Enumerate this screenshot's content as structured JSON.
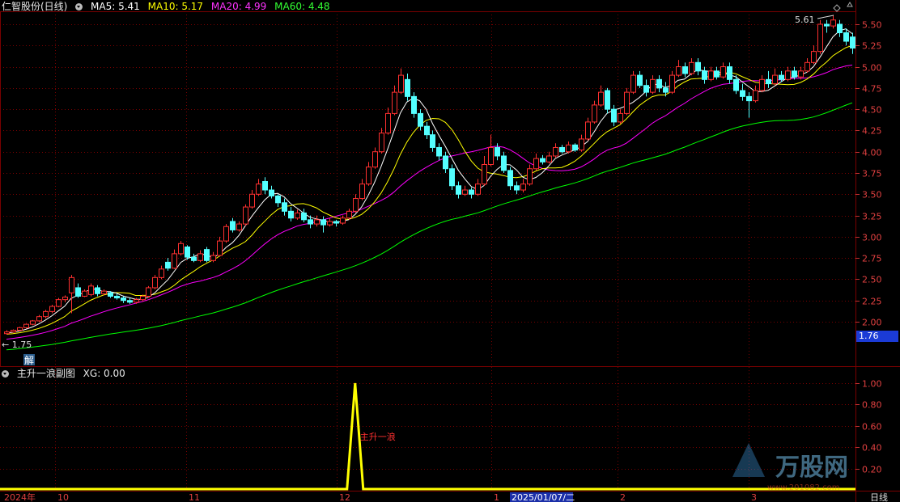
{
  "main_header": {
    "title": "仁智股份(日线)",
    "ma5": "MA5: 5.41",
    "ma10": "MA10: 5.17",
    "ma20": "MA20: 4.99",
    "ma60": "MA60: 4.48"
  },
  "sub_header": {
    "title": "主升一浪副图",
    "xg": "XG: 0.00"
  },
  "annotations": {
    "high_label": "5.61",
    "low_label": "1.75",
    "jie_label": "解",
    "signal_label": "主升一浪",
    "current_price": "1.76",
    "date_label": "2025/01/07/二",
    "period_label": "日线",
    "watermark_brand": "万股网",
    "watermark_url": "www.201082.com"
  },
  "colors": {
    "ma5": "#ffffff",
    "ma10": "#ffff00",
    "ma20": "#ff00ff",
    "ma60": "#00ff00",
    "up": "#ff3030",
    "down": "#54ffff",
    "indicator": "#ffff00",
    "grid": "#7a0000"
  },
  "chart_data": [
    {
      "type": "candlestick",
      "title": "仁智股份(日线)",
      "y_ticks": [
        "5.50",
        "5.25",
        "5.00",
        "4.75",
        "4.50",
        "4.25",
        "4.00",
        "3.75",
        "3.50",
        "3.25",
        "3.00",
        "2.75",
        "2.50",
        "2.25",
        "2.00"
      ],
      "ylim": [
        1.75,
        5.61
      ],
      "x_ticks": [
        "2024年",
        "10",
        "11",
        "12",
        "1",
        "2025/01/07/二",
        "2",
        "3"
      ],
      "candles": [
        [
          1.86,
          1.88,
          1.85,
          1.9
        ],
        [
          1.88,
          1.9,
          1.87,
          1.91
        ],
        [
          1.9,
          1.93,
          1.89,
          1.94
        ],
        [
          1.93,
          1.97,
          1.92,
          1.98
        ],
        [
          1.97,
          2.01,
          1.96,
          2.02
        ],
        [
          2.01,
          2.06,
          2.0,
          2.08
        ],
        [
          2.06,
          2.12,
          2.04,
          2.14
        ],
        [
          2.12,
          2.18,
          2.1,
          2.2
        ],
        [
          2.18,
          2.26,
          2.17,
          2.28
        ],
        [
          2.26,
          2.29,
          2.23,
          2.31
        ],
        [
          2.34,
          2.52,
          2.1,
          2.55
        ],
        [
          2.4,
          2.3,
          2.28,
          2.45
        ],
        [
          2.3,
          2.36,
          2.29,
          2.38
        ],
        [
          2.32,
          2.42,
          2.3,
          2.45
        ],
        [
          2.4,
          2.33,
          2.3,
          2.43
        ],
        [
          2.33,
          2.36,
          2.31,
          2.38
        ],
        [
          2.34,
          2.3,
          2.28,
          2.36
        ],
        [
          2.3,
          2.28,
          2.26,
          2.33
        ],
        [
          2.28,
          2.25,
          2.22,
          2.3
        ],
        [
          2.25,
          2.23,
          2.21,
          2.28
        ],
        [
          2.23,
          2.26,
          2.21,
          2.28
        ],
        [
          2.26,
          2.3,
          2.24,
          2.32
        ],
        [
          2.3,
          2.4,
          2.28,
          2.42
        ],
        [
          2.4,
          2.52,
          2.38,
          2.55
        ],
        [
          2.52,
          2.62,
          2.5,
          2.66
        ],
        [
          2.7,
          2.63,
          2.6,
          2.75
        ],
        [
          2.63,
          2.8,
          2.62,
          2.85
        ],
        [
          2.8,
          2.92,
          2.78,
          2.95
        ],
        [
          2.88,
          2.76,
          2.73,
          2.9
        ],
        [
          2.76,
          2.72,
          2.7,
          2.8
        ],
        [
          2.72,
          2.8,
          2.7,
          2.84
        ],
        [
          2.85,
          2.72,
          2.7,
          2.88
        ],
        [
          2.72,
          2.78,
          2.7,
          2.82
        ],
        [
          2.78,
          2.95,
          2.77,
          3.0
        ],
        [
          2.95,
          3.12,
          2.93,
          3.15
        ],
        [
          3.18,
          3.08,
          3.05,
          3.22
        ],
        [
          3.08,
          3.15,
          3.06,
          3.18
        ],
        [
          3.15,
          3.35,
          3.13,
          3.38
        ],
        [
          3.35,
          3.5,
          3.33,
          3.55
        ],
        [
          3.5,
          3.62,
          3.48,
          3.68
        ],
        [
          3.65,
          3.55,
          3.5,
          3.7
        ],
        [
          3.55,
          3.48,
          3.45,
          3.6
        ],
        [
          3.48,
          3.4,
          3.35,
          3.5
        ],
        [
          3.4,
          3.3,
          3.25,
          3.45
        ],
        [
          3.3,
          3.22,
          3.18,
          3.35
        ],
        [
          3.22,
          3.28,
          3.2,
          3.32
        ],
        [
          3.28,
          3.2,
          3.17,
          3.33
        ],
        [
          3.2,
          3.15,
          3.1,
          3.25
        ],
        [
          3.15,
          3.2,
          3.12,
          3.25
        ],
        [
          3.2,
          3.14,
          3.05,
          3.24
        ],
        [
          3.14,
          3.18,
          3.12,
          3.22
        ],
        [
          3.18,
          3.16,
          3.12,
          3.2
        ],
        [
          3.16,
          3.22,
          3.14,
          3.25
        ],
        [
          3.22,
          3.3,
          3.2,
          3.33
        ],
        [
          3.3,
          3.45,
          3.28,
          3.5
        ],
        [
          3.45,
          3.62,
          3.43,
          3.68
        ],
        [
          3.62,
          3.82,
          3.6,
          3.88
        ],
        [
          3.82,
          4.0,
          3.8,
          4.05
        ],
        [
          4.0,
          4.22,
          3.98,
          4.28
        ],
        [
          4.22,
          4.45,
          4.2,
          4.52
        ],
        [
          4.45,
          4.7,
          4.43,
          4.78
        ],
        [
          4.7,
          4.9,
          4.68,
          4.98
        ],
        [
          4.85,
          4.65,
          4.6,
          4.92
        ],
        [
          4.65,
          4.45,
          4.4,
          4.7
        ],
        [
          4.45,
          4.3,
          4.25,
          4.5
        ],
        [
          4.3,
          4.2,
          4.15,
          4.35
        ],
        [
          4.2,
          4.05,
          4.0,
          4.25
        ],
        [
          4.05,
          3.95,
          3.9,
          4.1
        ],
        [
          3.95,
          3.8,
          3.75,
          4.0
        ],
        [
          3.8,
          3.6,
          3.55,
          3.85
        ],
        [
          3.6,
          3.5,
          3.45,
          3.65
        ],
        [
          3.5,
          3.55,
          3.48,
          3.6
        ],
        [
          3.55,
          3.5,
          3.45,
          3.58
        ],
        [
          3.5,
          3.62,
          3.48,
          3.68
        ],
        [
          3.62,
          3.85,
          3.6,
          3.95
        ],
        [
          3.85,
          4.05,
          3.83,
          4.2
        ],
        [
          4.05,
          3.95,
          3.9,
          4.1
        ],
        [
          3.95,
          3.78,
          3.75,
          4.0
        ],
        [
          3.78,
          3.6,
          3.55,
          3.82
        ],
        [
          3.6,
          3.55,
          3.5,
          3.65
        ],
        [
          3.55,
          3.62,
          3.52,
          3.68
        ],
        [
          3.62,
          3.8,
          3.6,
          3.85
        ],
        [
          3.8,
          3.92,
          3.78,
          3.98
        ],
        [
          3.92,
          3.88,
          3.85,
          3.96
        ],
        [
          3.88,
          3.95,
          3.86,
          4.0
        ],
        [
          3.95,
          4.05,
          3.93,
          4.1
        ],
        [
          4.05,
          4.0,
          3.98,
          4.08
        ],
        [
          4.0,
          4.08,
          3.98,
          4.12
        ],
        [
          4.08,
          4.02,
          4.0,
          4.1
        ],
        [
          4.02,
          4.15,
          4.0,
          4.2
        ],
        [
          4.15,
          4.35,
          4.13,
          4.4
        ],
        [
          4.35,
          4.55,
          4.33,
          4.6
        ],
        [
          4.55,
          4.7,
          4.53,
          4.78
        ],
        [
          4.72,
          4.5,
          4.45,
          4.75
        ],
        [
          4.5,
          4.35,
          4.3,
          4.55
        ],
        [
          4.35,
          4.45,
          4.33,
          4.5
        ],
        [
          4.45,
          4.7,
          4.43,
          4.75
        ],
        [
          4.7,
          4.9,
          4.68,
          4.95
        ],
        [
          4.9,
          4.78,
          4.75,
          4.95
        ],
        [
          4.78,
          4.7,
          4.65,
          4.85
        ],
        [
          4.7,
          4.85,
          4.68,
          4.9
        ],
        [
          4.85,
          4.75,
          4.7,
          4.9
        ],
        [
          4.75,
          4.7,
          4.65,
          4.82
        ],
        [
          4.7,
          4.9,
          4.68,
          4.95
        ],
        [
          4.9,
          5.0,
          4.88,
          5.08
        ],
        [
          5.0,
          4.92,
          4.88,
          5.05
        ],
        [
          4.92,
          5.05,
          4.9,
          5.1
        ],
        [
          5.05,
          4.95,
          4.9,
          5.1
        ],
        [
          4.95,
          4.85,
          4.8,
          5.0
        ],
        [
          4.85,
          4.95,
          4.83,
          5.0
        ],
        [
          4.95,
          4.88,
          4.85,
          5.0
        ],
        [
          4.88,
          5.0,
          4.86,
          5.05
        ],
        [
          5.0,
          4.85,
          4.8,
          5.05
        ],
        [
          4.85,
          4.72,
          4.68,
          4.9
        ],
        [
          4.72,
          4.65,
          4.6,
          4.8
        ],
        [
          4.65,
          4.6,
          4.4,
          4.7
        ],
        [
          4.6,
          4.72,
          4.58,
          4.78
        ],
        [
          4.72,
          4.85,
          4.7,
          4.9
        ],
        [
          4.85,
          4.8,
          4.75,
          4.95
        ],
        [
          4.8,
          4.9,
          4.78,
          4.98
        ],
        [
          4.9,
          4.85,
          4.82,
          4.95
        ],
        [
          4.85,
          4.95,
          4.83,
          5.0
        ],
        [
          4.95,
          4.88,
          4.85,
          5.0
        ],
        [
          4.88,
          4.95,
          4.85,
          5.0
        ],
        [
          4.95,
          5.05,
          4.93,
          5.1
        ],
        [
          5.05,
          5.18,
          5.03,
          5.25
        ],
        [
          5.18,
          5.5,
          5.15,
          5.55
        ],
        [
          5.5,
          5.48,
          5.4,
          5.55
        ],
        [
          5.48,
          5.55,
          5.45,
          5.61
        ],
        [
          5.5,
          5.4,
          5.35,
          5.55
        ],
        [
          5.4,
          5.3,
          5.25,
          5.45
        ],
        [
          5.35,
          5.22,
          5.15,
          5.4
        ]
      ],
      "ma5_end": 5.41,
      "ma10_end": 5.17,
      "ma20_end": 4.99,
      "ma60_end": 4.48
    },
    {
      "type": "line",
      "title": "主升一浪副图",
      "y_ticks": [
        "1.00",
        "0.80",
        "0.60",
        "0.40",
        "0.20"
      ],
      "ylim": [
        0,
        1.0
      ],
      "series": [
        {
          "name": "XG",
          "signal_bar_index": 54,
          "signal_value": 1.0,
          "baseline": 0.0
        }
      ]
    }
  ]
}
